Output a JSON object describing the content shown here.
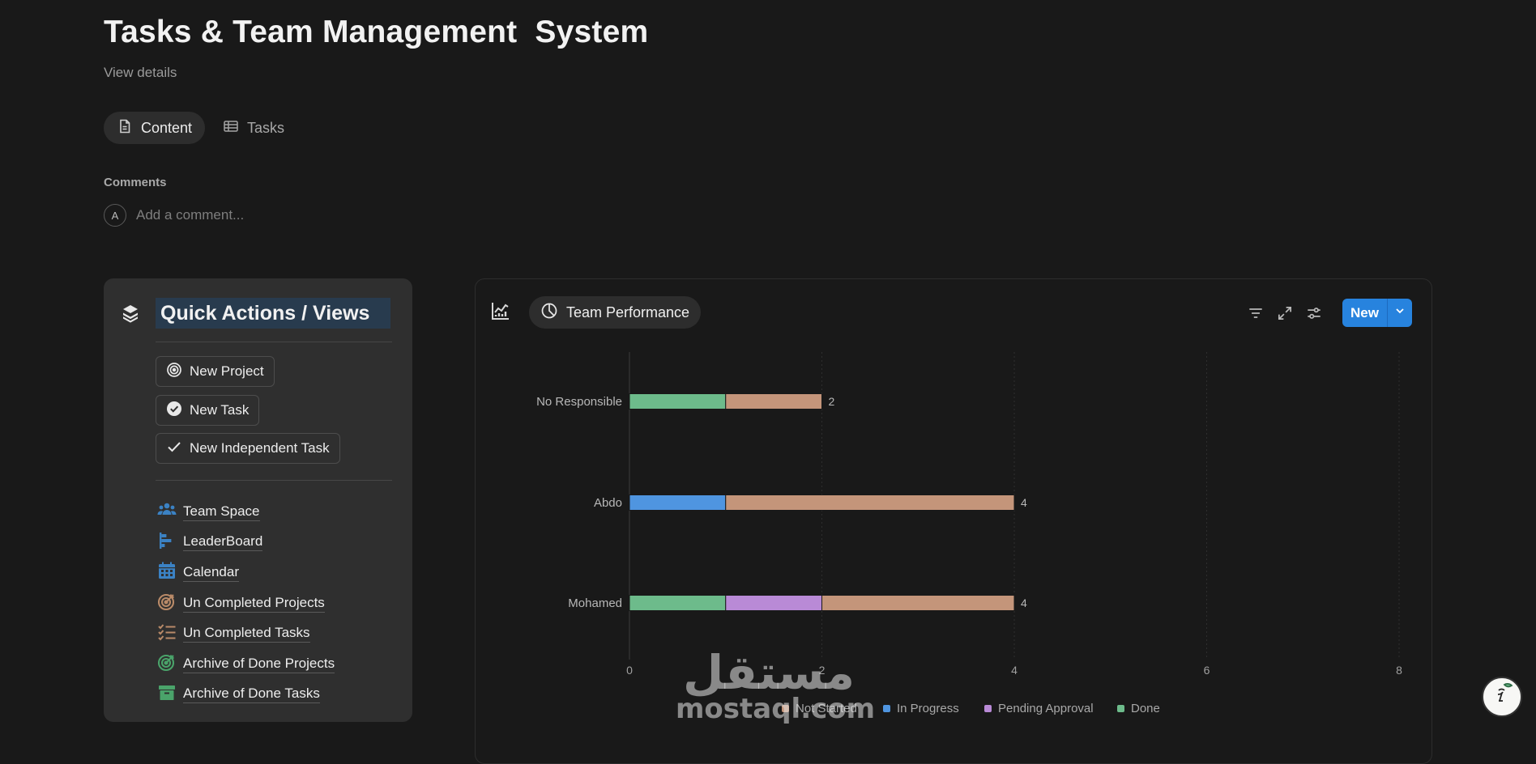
{
  "page": {
    "title": "Tasks & Team Management  System",
    "view_details": "View details"
  },
  "tabs": [
    {
      "label": "Content",
      "icon": "document-icon",
      "active": true
    },
    {
      "label": "Tasks",
      "icon": "table-icon",
      "active": false
    }
  ],
  "comments": {
    "label": "Comments",
    "avatar_initial": "A",
    "placeholder": "Add a comment..."
  },
  "quick_actions": {
    "heading": "Quick Actions / Views",
    "buttons": [
      {
        "label": "New Project",
        "icon": "target-icon"
      },
      {
        "label": "New Task",
        "icon": "check-circle-icon"
      },
      {
        "label": "New Independent Task",
        "icon": "checkmark-icon"
      }
    ],
    "links": [
      {
        "label": "Team Space",
        "icon": "people-icon",
        "color": "#3b82c4"
      },
      {
        "label": "LeaderBoard",
        "icon": "leaderboard-icon",
        "color": "#3b82c4"
      },
      {
        "label": "Calendar",
        "icon": "calendar-icon",
        "color": "#3b82c4"
      },
      {
        "label": "Un Completed Projects",
        "icon": "target-icon",
        "color": "#b98a68"
      },
      {
        "label": "Un Completed Tasks",
        "icon": "checklist-icon",
        "color": "#b98a68"
      },
      {
        "label": "Archive of Done Projects",
        "icon": "target-icon",
        "color": "#4aa36a"
      },
      {
        "label": "Archive of Done Tasks",
        "icon": "archive-icon",
        "color": "#4aa36a"
      }
    ]
  },
  "chart_view": {
    "tab_label": "Team Performance",
    "new_label": "New"
  },
  "chart_data": {
    "type": "bar",
    "orientation": "horizontal",
    "stacked": true,
    "categories": [
      "No Responsible",
      "Abdo",
      "Mohamed"
    ],
    "series": [
      {
        "name": "Done",
        "color": "#6dbb8b",
        "values": [
          1,
          0,
          1
        ]
      },
      {
        "name": "In Progress",
        "color": "#4f95e0",
        "values": [
          0,
          1,
          0
        ]
      },
      {
        "name": "Pending Approval",
        "color": "#b98ad6",
        "values": [
          0,
          0,
          1
        ]
      },
      {
        "name": "Not Started",
        "color": "#c4957a",
        "values": [
          1,
          3,
          2
        ]
      }
    ],
    "totals": [
      2,
      4,
      4
    ],
    "x_ticks": [
      0,
      2,
      4,
      6,
      8
    ],
    "xlim": [
      0,
      8
    ],
    "legend_order": [
      "Not Started",
      "In Progress",
      "Pending Approval",
      "Done"
    ],
    "legend_position": "bottom",
    "grid": "vertical dashed"
  },
  "watermark": {
    "arabic": "مستقل",
    "latin": "mostaql.com"
  }
}
